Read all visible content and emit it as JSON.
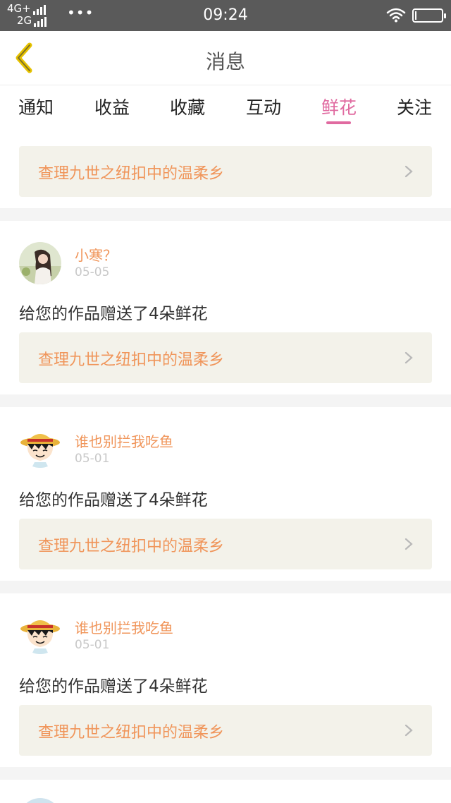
{
  "status_bar": {
    "network_1": "4G+",
    "network_2": "2G",
    "dots": "•••",
    "time": "09:24"
  },
  "header": {
    "title": "消息",
    "back_icon": "chevron-left-icon",
    "accent_color": "#e6c200"
  },
  "tabs": [
    {
      "label": "通知"
    },
    {
      "label": "收益"
    },
    {
      "label": "收藏"
    },
    {
      "label": "互动"
    },
    {
      "label": "鲜花",
      "active": true
    },
    {
      "label": "关注"
    }
  ],
  "colors": {
    "active_tab": "#e06aa0",
    "link_text": "#f0955a",
    "link_bg": "#f3f2ea"
  },
  "feed": {
    "partial_link": "查理九世之纽扣中的温柔乡",
    "items": [
      {
        "user": "小寒？",
        "date": "05-05",
        "message": "给您的作品赠送了4朵鲜花",
        "work_title": "查理九世之纽扣中的温柔乡"
      },
      {
        "user": "谁也别拦我吃鱼",
        "date": "05-01",
        "message": "给您的作品赠送了4朵鲜花",
        "work_title": "查理九世之纽扣中的温柔乡"
      },
      {
        "user": "谁也别拦我吃鱼",
        "date": "05-01",
        "message": "给您的作品赠送了4朵鲜花",
        "work_title": "查理九世之纽扣中的温柔乡"
      }
    ]
  }
}
